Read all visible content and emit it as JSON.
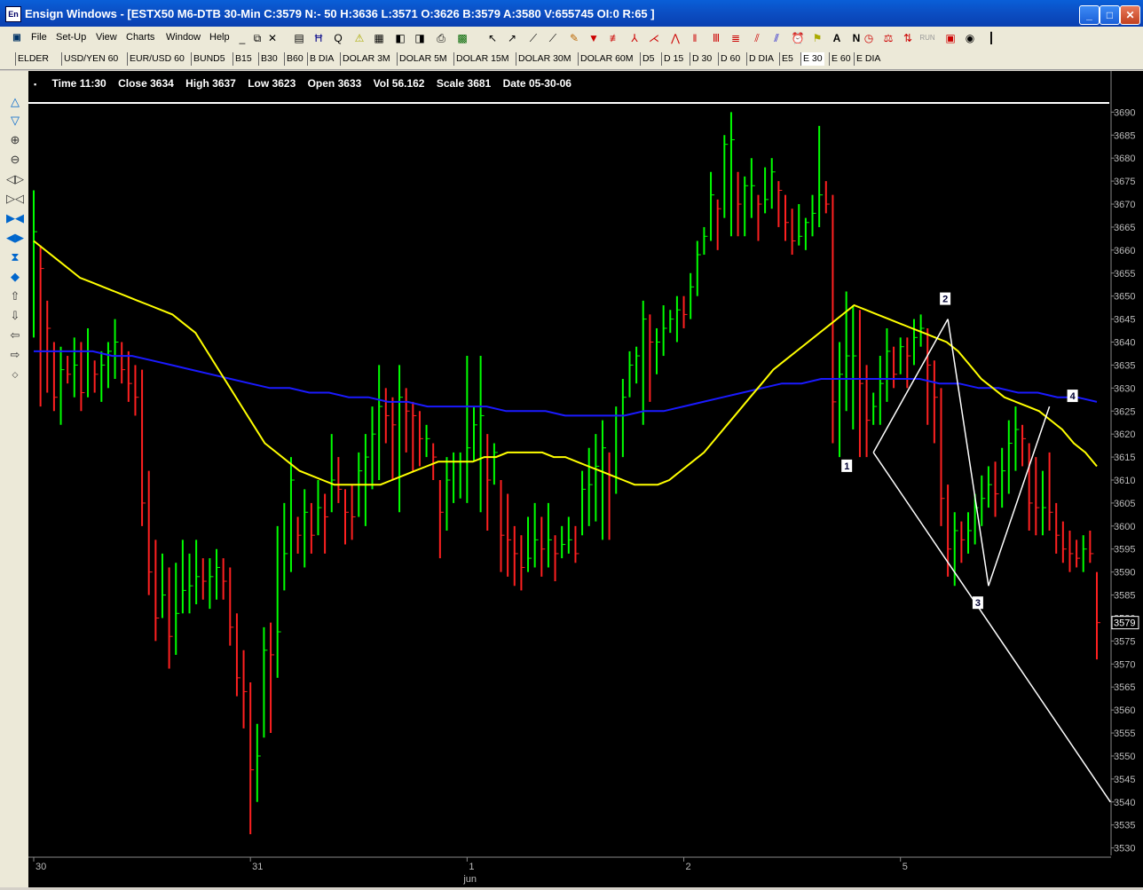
{
  "window": {
    "app_icon": "En",
    "title": "Ensign Windows - [ESTX50 M6-DTB 30-Min C:3579 N:- 50 H:3636 L:3571 O:3626 B:3579 A:3580 V:655745 OI:0 R:65 ]",
    "minimize_icon": "minimize-icon",
    "maximize_icon": "maximize-icon",
    "close_icon": "close-icon"
  },
  "menu": [
    "File",
    "Set-Up",
    "View",
    "Charts",
    "Window",
    "Help"
  ],
  "tabs": [
    "ELDER",
    "USD/YEN 60",
    "EUR/USD 60",
    "BUND5",
    "B15",
    "B30",
    "B60",
    "B DIA",
    "DOLAR 3M",
    "DOLAR 5M",
    "DOLAR 15M",
    "DOLAR 30M",
    "DOLAR 60M",
    "D5",
    "D 15",
    "D 30",
    "D 60",
    "D DIA",
    "E5",
    "E 30",
    "E 60",
    "E DIA"
  ],
  "active_tab": "E 30",
  "info": {
    "time_label": "Time",
    "time": "11:30",
    "close_label": "Close",
    "close": "3634",
    "high_label": "High",
    "high": "3637",
    "low_label": "Low",
    "low": "3623",
    "open_label": "Open",
    "open": "3633",
    "vol_label": "Vol",
    "vol": "56.162",
    "scale_label": "Scale",
    "scale": "3681",
    "date_label": "Date",
    "date": "05-30-06"
  },
  "chart_data": {
    "type": "ohlc",
    "colors": {
      "up": "#00ff00",
      "down": "#ff2020",
      "ma_fast": "#ffff00",
      "ma_slow": "#1a1aff",
      "background": "#000000",
      "pattern": "#ffffff"
    },
    "y_ticks": [
      3690,
      3685,
      3680,
      3675,
      3670,
      3665,
      3660,
      3655,
      3650,
      3645,
      3640,
      3635,
      3630,
      3625,
      3620,
      3615,
      3610,
      3605,
      3600,
      3595,
      3590,
      3585,
      3580,
      3575,
      3570,
      3565,
      3560,
      3555,
      3550,
      3545,
      3540,
      3535,
      3530
    ],
    "ylim": [
      3528,
      3692
    ],
    "last_price": "3579",
    "x_labels": [
      "30",
      "31",
      "1",
      "2",
      "5"
    ],
    "month_label": "jun",
    "bars": [
      {
        "h": 3673,
        "l": 3641,
        "c": 3664
      },
      {
        "h": 3661,
        "l": 3626,
        "c": 3656
      },
      {
        "h": 3649,
        "l": 3629,
        "c": 3643
      },
      {
        "h": 3640,
        "l": 3625,
        "c": 3628
      },
      {
        "h": 3639,
        "l": 3622,
        "c": 3634
      },
      {
        "h": 3637,
        "l": 3631,
        "c": 3633
      },
      {
        "h": 3641,
        "l": 3628,
        "c": 3635
      },
      {
        "h": 3640,
        "l": 3625,
        "c": 3629
      },
      {
        "h": 3643,
        "l": 3628,
        "c": 3638
      },
      {
        "h": 3636,
        "l": 3629,
        "c": 3633
      },
      {
        "h": 3638,
        "l": 3627,
        "c": 3635
      },
      {
        "h": 3640,
        "l": 3630,
        "c": 3638
      },
      {
        "h": 3645,
        "l": 3632,
        "c": 3640
      },
      {
        "h": 3640,
        "l": 3631,
        "c": 3634
      },
      {
        "h": 3638,
        "l": 3627,
        "c": 3631
      },
      {
        "h": 3635,
        "l": 3624,
        "c": 3628
      },
      {
        "h": 3634,
        "l": 3600,
        "c": 3605
      },
      {
        "h": 3612,
        "l": 3585,
        "c": 3590
      },
      {
        "h": 3597,
        "l": 3575,
        "c": 3580
      },
      {
        "h": 3594,
        "l": 3580,
        "c": 3585
      },
      {
        "h": 3591,
        "l": 3569,
        "c": 3576
      },
      {
        "h": 3592,
        "l": 3572,
        "c": 3581
      },
      {
        "h": 3597,
        "l": 3581,
        "c": 3586
      },
      {
        "h": 3594,
        "l": 3581,
        "c": 3587
      },
      {
        "h": 3597,
        "l": 3583,
        "c": 3589
      },
      {
        "h": 3593,
        "l": 3584,
        "c": 3588
      },
      {
        "h": 3593,
        "l": 3582,
        "c": 3589
      },
      {
        "h": 3595,
        "l": 3584,
        "c": 3591
      },
      {
        "h": 3593,
        "l": 3584,
        "c": 3588
      },
      {
        "h": 3591,
        "l": 3574,
        "c": 3578
      },
      {
        "h": 3581,
        "l": 3563,
        "c": 3567
      },
      {
        "h": 3573,
        "l": 3556,
        "c": 3564
      },
      {
        "h": 3566,
        "l": 3533,
        "c": 3547
      },
      {
        "h": 3557,
        "l": 3540,
        "c": 3550
      },
      {
        "h": 3578,
        "l": 3554,
        "c": 3573
      },
      {
        "h": 3579,
        "l": 3555,
        "c": 3572
      },
      {
        "h": 3600,
        "l": 3567,
        "c": 3577
      },
      {
        "h": 3605,
        "l": 3586,
        "c": 3594
      },
      {
        "h": 3615,
        "l": 3590,
        "c": 3610
      },
      {
        "h": 3602,
        "l": 3594,
        "c": 3598
      },
      {
        "h": 3608,
        "l": 3591,
        "c": 3603
      },
      {
        "h": 3605,
        "l": 3594,
        "c": 3598
      },
      {
        "h": 3610,
        "l": 3598,
        "c": 3604
      },
      {
        "h": 3607,
        "l": 3594,
        "c": 3602
      },
      {
        "h": 3620,
        "l": 3603,
        "c": 3610
      },
      {
        "h": 3615,
        "l": 3605,
        "c": 3608
      },
      {
        "h": 3608,
        "l": 3596,
        "c": 3603
      },
      {
        "h": 3609,
        "l": 3597,
        "c": 3602
      },
      {
        "h": 3616,
        "l": 3602,
        "c": 3612
      },
      {
        "h": 3620,
        "l": 3600,
        "c": 3615
      },
      {
        "h": 3626,
        "l": 3608,
        "c": 3620
      },
      {
        "h": 3635,
        "l": 3610,
        "c": 3626
      },
      {
        "h": 3630,
        "l": 3618,
        "c": 3624
      },
      {
        "h": 3628,
        "l": 3610,
        "c": 3622
      },
      {
        "h": 3635,
        "l": 3603,
        "c": 3628
      },
      {
        "h": 3630,
        "l": 3616,
        "c": 3625
      },
      {
        "h": 3627,
        "l": 3612,
        "c": 3624
      },
      {
        "h": 3625,
        "l": 3613,
        "c": 3619
      },
      {
        "h": 3622,
        "l": 3615,
        "c": 3619
      },
      {
        "h": 3618,
        "l": 3610,
        "c": 3615
      },
      {
        "h": 3610,
        "l": 3593,
        "c": 3603
      },
      {
        "h": 3615,
        "l": 3599,
        "c": 3610
      },
      {
        "h": 3616,
        "l": 3605,
        "c": 3614
      },
      {
        "h": 3616,
        "l": 3606,
        "c": 3614
      },
      {
        "h": 3637,
        "l": 3605,
        "c": 3617
      },
      {
        "h": 3626,
        "l": 3614,
        "c": 3622
      },
      {
        "h": 3637,
        "l": 3603,
        "c": 3624
      },
      {
        "h": 3620,
        "l": 3599,
        "c": 3610
      },
      {
        "h": 3618,
        "l": 3609,
        "c": 3616
      },
      {
        "h": 3610,
        "l": 3590,
        "c": 3598
      },
      {
        "h": 3607,
        "l": 3589,
        "c": 3597
      },
      {
        "h": 3600,
        "l": 3587,
        "c": 3594
      },
      {
        "h": 3598,
        "l": 3586,
        "c": 3591
      },
      {
        "h": 3602,
        "l": 3590,
        "c": 3593
      },
      {
        "h": 3605,
        "l": 3591,
        "c": 3597
      },
      {
        "h": 3602,
        "l": 3589,
        "c": 3595
      },
      {
        "h": 3605,
        "l": 3591,
        "c": 3597
      },
      {
        "h": 3598,
        "l": 3588,
        "c": 3594
      },
      {
        "h": 3600,
        "l": 3593,
        "c": 3596
      },
      {
        "h": 3602,
        "l": 3594,
        "c": 3597
      },
      {
        "h": 3600,
        "l": 3592,
        "c": 3594
      },
      {
        "h": 3612,
        "l": 3598,
        "c": 3608
      },
      {
        "h": 3617,
        "l": 3600,
        "c": 3609
      },
      {
        "h": 3620,
        "l": 3601,
        "c": 3613
      },
      {
        "h": 3623,
        "l": 3597,
        "c": 3617
      },
      {
        "h": 3616,
        "l": 3597,
        "c": 3611
      },
      {
        "h": 3626,
        "l": 3607,
        "c": 3624
      },
      {
        "h": 3632,
        "l": 3615,
        "c": 3628
      },
      {
        "h": 3638,
        "l": 3628,
        "c": 3635
      },
      {
        "h": 3639,
        "l": 3631,
        "c": 3637
      },
      {
        "h": 3649,
        "l": 3622,
        "c": 3645
      },
      {
        "h": 3646,
        "l": 3627,
        "c": 3640
      },
      {
        "h": 3643,
        "l": 3633,
        "c": 3640
      },
      {
        "h": 3648,
        "l": 3637,
        "c": 3643
      },
      {
        "h": 3647,
        "l": 3642,
        "c": 3645
      },
      {
        "h": 3650,
        "l": 3640,
        "c": 3647
      },
      {
        "h": 3650,
        "l": 3643,
        "c": 3646
      },
      {
        "h": 3655,
        "l": 3645,
        "c": 3652
      },
      {
        "h": 3662,
        "l": 3650,
        "c": 3659
      },
      {
        "h": 3665,
        "l": 3659,
        "c": 3663
      },
      {
        "h": 3677,
        "l": 3662,
        "c": 3672
      },
      {
        "h": 3671,
        "l": 3660,
        "c": 3669
      },
      {
        "h": 3685,
        "l": 3667,
        "c": 3683
      },
      {
        "h": 3690,
        "l": 3663,
        "c": 3684
      },
      {
        "h": 3677,
        "l": 3663,
        "c": 3670
      },
      {
        "h": 3676,
        "l": 3663,
        "c": 3674
      },
      {
        "h": 3680,
        "l": 3667,
        "c": 3674
      },
      {
        "h": 3672,
        "l": 3662,
        "c": 3670
      },
      {
        "h": 3678,
        "l": 3668,
        "c": 3671
      },
      {
        "h": 3680,
        "l": 3669,
        "c": 3677
      },
      {
        "h": 3675,
        "l": 3665,
        "c": 3673
      },
      {
        "h": 3672,
        "l": 3662,
        "c": 3666
      },
      {
        "h": 3669,
        "l": 3659,
        "c": 3662
      },
      {
        "h": 3670,
        "l": 3661,
        "c": 3663
      },
      {
        "h": 3667,
        "l": 3660,
        "c": 3666
      },
      {
        "h": 3672,
        "l": 3663,
        "c": 3668
      },
      {
        "h": 3687,
        "l": 3665,
        "c": 3672
      },
      {
        "h": 3675,
        "l": 3668,
        "c": 3670
      },
      {
        "h": 3672,
        "l": 3618,
        "c": 3627
      },
      {
        "h": 3640,
        "l": 3615,
        "c": 3633
      },
      {
        "h": 3651,
        "l": 3625,
        "c": 3637
      },
      {
        "h": 3648,
        "l": 3621,
        "c": 3637
      },
      {
        "h": 3647,
        "l": 3615,
        "c": 3631
      },
      {
        "h": 3635,
        "l": 3615,
        "c": 3623
      },
      {
        "h": 3629,
        "l": 3622,
        "c": 3626
      },
      {
        "h": 3637,
        "l": 3622,
        "c": 3631
      },
      {
        "h": 3643,
        "l": 3627,
        "c": 3638
      },
      {
        "h": 3639,
        "l": 3630,
        "c": 3633
      },
      {
        "h": 3641,
        "l": 3633,
        "c": 3639
      },
      {
        "h": 3641,
        "l": 3630,
        "c": 3637
      },
      {
        "h": 3645,
        "l": 3635,
        "c": 3641
      },
      {
        "h": 3646,
        "l": 3639,
        "c": 3643
      },
      {
        "h": 3643,
        "l": 3622,
        "c": 3635
      },
      {
        "h": 3636,
        "l": 3618,
        "c": 3628
      },
      {
        "h": 3630,
        "l": 3600,
        "c": 3606
      },
      {
        "h": 3609,
        "l": 3589,
        "c": 3595
      },
      {
        "h": 3603,
        "l": 3587,
        "c": 3599
      },
      {
        "h": 3601,
        "l": 3592,
        "c": 3597
      },
      {
        "h": 3603,
        "l": 3594,
        "c": 3599
      },
      {
        "h": 3607,
        "l": 3596,
        "c": 3604
      },
      {
        "h": 3611,
        "l": 3600,
        "c": 3606
      },
      {
        "h": 3613,
        "l": 3604,
        "c": 3609
      },
      {
        "h": 3614,
        "l": 3602,
        "c": 3607
      },
      {
        "h": 3617,
        "l": 3604,
        "c": 3612
      },
      {
        "h": 3623,
        "l": 3607,
        "c": 3618
      },
      {
        "h": 3626,
        "l": 3612,
        "c": 3621
      },
      {
        "h": 3622,
        "l": 3613,
        "c": 3619
      },
      {
        "h": 3618,
        "l": 3599,
        "c": 3605
      },
      {
        "h": 3615,
        "l": 3598,
        "c": 3604
      },
      {
        "h": 3612,
        "l": 3598,
        "c": 3604
      },
      {
        "h": 3616,
        "l": 3599,
        "c": 3603
      },
      {
        "h": 3605,
        "l": 3594,
        "c": 3598
      },
      {
        "h": 3601,
        "l": 3592,
        "c": 3595
      },
      {
        "h": 3599,
        "l": 3590,
        "c": 3594
      },
      {
        "h": 3597,
        "l": 3591,
        "c": 3593
      },
      {
        "h": 3598,
        "l": 3590,
        "c": 3595
      },
      {
        "h": 3599,
        "l": 3592,
        "c": 3594
      },
      {
        "h": 3590,
        "l": 3571,
        "c": 3579
      }
    ],
    "ma_fast_values": [
      3662,
      3660,
      3658,
      3656,
      3654,
      3653,
      3652,
      3651,
      3650,
      3649,
      3648,
      3647,
      3646,
      3644,
      3642,
      3638,
      3634,
      3630,
      3626,
      3622,
      3618,
      3616,
      3614,
      3612,
      3611,
      3610,
      3609,
      3609,
      3609,
      3609,
      3609,
      3610,
      3611,
      3612,
      3613,
      3614,
      3614,
      3614,
      3614,
      3615,
      3615,
      3616,
      3616,
      3616,
      3616,
      3615,
      3615,
      3614,
      3613,
      3612,
      3611,
      3610,
      3609,
      3609,
      3609,
      3610,
      3612,
      3614,
      3616,
      3619,
      3622,
      3625,
      3628,
      3631,
      3634,
      3636,
      3638,
      3640,
      3642,
      3644,
      3646,
      3648,
      3647,
      3646,
      3645,
      3644,
      3643,
      3642,
      3641,
      3640,
      3638,
      3635,
      3632,
      3630,
      3628,
      3627,
      3626,
      3625,
      3623,
      3621,
      3618,
      3616,
      3613
    ],
    "ma_slow_values": [
      3638,
      3638,
      3638,
      3638,
      3637,
      3637,
      3636,
      3635,
      3634,
      3633,
      3632,
      3631,
      3630,
      3630,
      3629,
      3629,
      3628,
      3628,
      3627,
      3627,
      3626,
      3626,
      3626,
      3626,
      3625,
      3625,
      3625,
      3624,
      3624,
      3624,
      3624,
      3625,
      3625,
      3626,
      3627,
      3628,
      3629,
      3630,
      3631,
      3631,
      3632,
      3632,
      3632,
      3632,
      3632,
      3632,
      3631,
      3631,
      3630,
      3630,
      3629,
      3629,
      3628,
      3628,
      3627
    ],
    "pattern": {
      "labels": [
        "1",
        "2",
        "3",
        "4"
      ],
      "points": [
        {
          "bar": 124,
          "price": 3616
        },
        {
          "bar": 135,
          "price": 3645
        },
        {
          "bar": 141,
          "price": 3587
        },
        {
          "bar": 150,
          "price": 3626
        }
      ],
      "projection_end": {
        "bar": 159,
        "price": 3540
      }
    }
  }
}
